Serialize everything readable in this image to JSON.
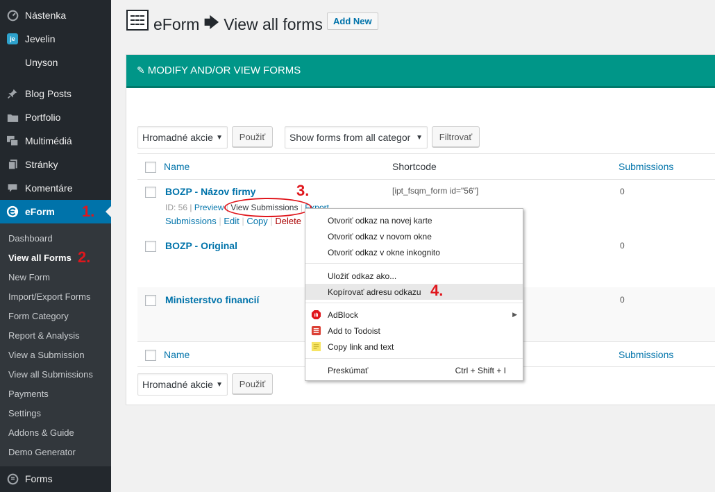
{
  "sidebar": {
    "top_items": [
      {
        "label": "Nástenka",
        "icon": "dashboard-icon"
      },
      {
        "label": "Jevelin",
        "icon": "je-logo-icon"
      },
      {
        "label": "Unyson",
        "icon": ""
      },
      {
        "label": "Blog Posts",
        "icon": "pin-icon"
      },
      {
        "label": "Portfolio",
        "icon": "folder-icon"
      },
      {
        "label": "Multimédiá",
        "icon": "media-icon"
      },
      {
        "label": "Stránky",
        "icon": "pages-icon"
      },
      {
        "label": "Komentáre",
        "icon": "comment-icon"
      },
      {
        "label": "eForm",
        "icon": "eform-icon"
      }
    ],
    "submenu": [
      "Dashboard",
      "View all Forms",
      "New Form",
      "Import/Export Forms",
      "Form Category",
      "Report & Analysis",
      "View a Submission",
      "View all Submissions",
      "Payments",
      "Settings",
      "Addons & Guide",
      "Demo Generator"
    ],
    "bottom_item": {
      "label": "Forms",
      "icon": "forms-icon"
    }
  },
  "annotations": {
    "n1": "1.",
    "n2": "2.",
    "n3": "3.",
    "n4": "4."
  },
  "header": {
    "app": "eForm",
    "arrow": "🡆",
    "page": "View all forms",
    "add_new": "Add New"
  },
  "panel": {
    "title": "MODIFY AND/OR VIEW FORMS"
  },
  "toolbar": {
    "bulk_actions": "Hromadné akcie",
    "apply": "Použiť",
    "category_filter": "Show forms from all categor",
    "filter": "Filtrovať"
  },
  "table": {
    "columns": {
      "name": "Name",
      "shortcode": "Shortcode",
      "submissions": "Submissions"
    },
    "rows": [
      {
        "title": "BOZP - Názov firmy",
        "shortcode": "[ipt_fsqm_form id=\"56\"]",
        "submissions": "0"
      },
      {
        "title": "BOZP - Original",
        "shortcode": "",
        "submissions": "0"
      },
      {
        "title": "Ministerstvo financií",
        "shortcode": "",
        "submissions": "0"
      }
    ],
    "row_actions": {
      "id": "ID: 56 |",
      "preview": "Preview",
      "view_submissions": "View Submissions",
      "export": "Export",
      "submissions": "Submissions",
      "edit": "Edit",
      "copy": "Copy",
      "delete": "Delete"
    }
  },
  "context_menu": {
    "items": [
      "Otvoriť odkaz na novej karte",
      "Otvoriť odkaz v novom okne",
      "Otvoriť odkaz v okne inkognito",
      "Uložiť odkaz ako...",
      "Kopírovať adresu odkazu",
      "AdBlock",
      "Add to Todoist",
      "Copy link and text",
      "Preskúmať"
    ],
    "inspect_shortcut": "Ctrl + Shift + I"
  }
}
